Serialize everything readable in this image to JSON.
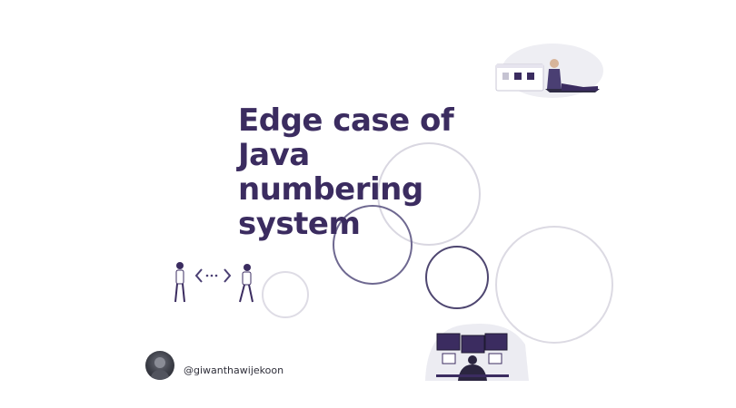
{
  "slide": {
    "title_lines": [
      "Edge case of",
      "Java",
      "numbering",
      "system"
    ],
    "author_handle": "@giwanthawijekoon"
  },
  "colors": {
    "title": "#3b2c60",
    "accent": "#4a3f73",
    "circle_light": "#d7d5df",
    "circle_dark": "#4e4670"
  },
  "illustrations": {
    "top_right": "person-sitting-at-laptop-illustration",
    "left": "two-people-code-exchange-illustration",
    "bottom": "developer-at-monitors-illustration"
  }
}
